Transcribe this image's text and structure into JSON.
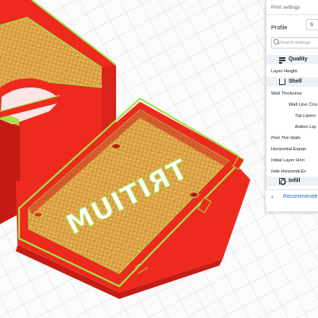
{
  "panel": {
    "title": "Print settings",
    "profile_label": "Profile",
    "profile_value": "S",
    "search_placeholder": "Search settings",
    "categories": {
      "quality": "Quality",
      "shell": "Shell",
      "infill": "Infill"
    },
    "settings": {
      "layer_height": "Layer Height",
      "wall_thickness": "Wall Thickness",
      "wall_line_count": "Wall Line Cou",
      "top_layers": "Top Layers",
      "bottom_layers": "Bottom Lay",
      "print_thin_walls": "Print Thin Walls",
      "horizontal_expansion": "Horizontal Expan",
      "initial_layer_horizontal": "Initial Layer Hori",
      "hole_horizontal": "Hole Horizontal Ex"
    },
    "recommended_label": "Recommende"
  },
  "model": {
    "engraved_text": "TRITIUM",
    "colors": {
      "shell": "#ee2a1e",
      "shell_dark": "#c41c14",
      "infill": "#e7a84c",
      "infill_line": "#c9862f",
      "highlight": "#a8e04a",
      "build_plate": "#fbfbfb",
      "grid": "#cfcfcf"
    }
  }
}
